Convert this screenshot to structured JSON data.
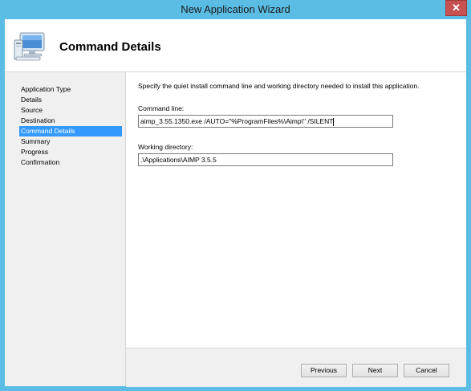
{
  "window": {
    "title": "New Application Wizard",
    "close_label": "✕"
  },
  "header": {
    "title": "Command Details",
    "icon": "computer-icon"
  },
  "sidebar": {
    "items": [
      {
        "label": "Application Type",
        "active": false
      },
      {
        "label": "Details",
        "active": false
      },
      {
        "label": "Source",
        "active": false
      },
      {
        "label": "Destination",
        "active": false
      },
      {
        "label": "Command Details",
        "active": true
      },
      {
        "label": "Summary",
        "active": false
      },
      {
        "label": "Progress",
        "active": false
      },
      {
        "label": "Confirmation",
        "active": false
      }
    ]
  },
  "main": {
    "description": "Specify the quiet install command line and working directory needed to install this application.",
    "command_line": {
      "label": "Command line:",
      "value": "aimp_3.55.1350.exe /AUTO=\"%ProgramFiles%\\Aimp\\\" /SILENT"
    },
    "working_directory": {
      "label": "Working directory:",
      "value": ".\\Applications\\AIMP 3.5.5"
    }
  },
  "buttons": {
    "previous": "Previous",
    "next": "Next",
    "cancel": "Cancel"
  },
  "colors": {
    "frame": "#5bbde4",
    "selection": "#3399ff",
    "close": "#c75050"
  }
}
